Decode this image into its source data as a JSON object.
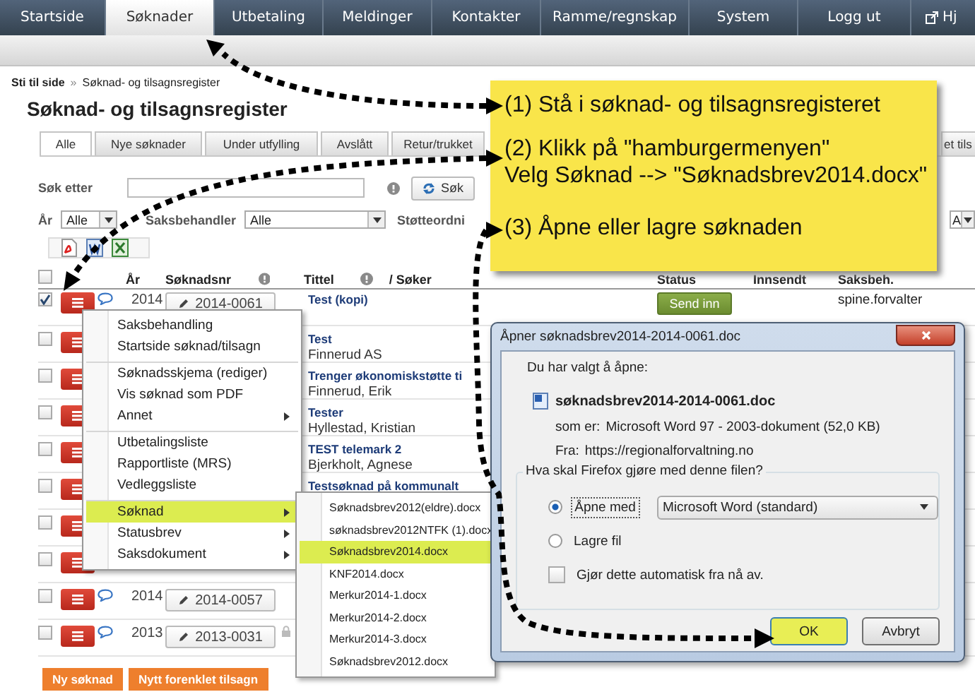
{
  "nav": [
    {
      "label": "Startside",
      "selected": false,
      "kind": "page"
    },
    {
      "label": "Søknader",
      "selected": true,
      "kind": "page"
    },
    {
      "label": "Utbetaling",
      "selected": false,
      "kind": "page"
    },
    {
      "label": "Meldinger",
      "selected": false,
      "kind": "page"
    },
    {
      "label": "Kontakter",
      "selected": false,
      "kind": "page"
    },
    {
      "label": "Ramme/regnskap",
      "selected": false,
      "kind": "page"
    },
    {
      "label": "System",
      "selected": false,
      "kind": "page"
    },
    {
      "label": "Logg ut",
      "selected": false,
      "kind": "page"
    },
    {
      "label": "Hj",
      "selected": false,
      "kind": "external"
    }
  ],
  "breadcrumb": {
    "link": "Sti til side",
    "separator": "»",
    "current": "Søknad- og tilsagnsregister"
  },
  "page_title": "Søknad- og tilsagnsregister",
  "tabs": [
    {
      "label": "Alle",
      "selected": true
    },
    {
      "label": "Nye søknader",
      "selected": false
    },
    {
      "label": "Under utfylling",
      "selected": false
    },
    {
      "label": "Avslått",
      "selected": false
    },
    {
      "label": "Retur/trukket",
      "selected": false
    },
    {
      "label": "et tils",
      "selected": false
    }
  ],
  "search": {
    "label": "Søk etter",
    "button": "Søk"
  },
  "filters": [
    {
      "label": "År",
      "value": "Alle"
    },
    {
      "label": "Saksbehandler",
      "value": "Alle"
    },
    {
      "label": "Støtteordni"
    },
    {
      "value": "A"
    }
  ],
  "table": {
    "all_checked": false,
    "columns": [
      {
        "label": "År"
      },
      {
        "label": "Søknadsnr",
        "help": true
      },
      {
        "label": "Tittel",
        "help": true,
        "suffix": "/ Søker"
      },
      {
        "label": "Status"
      },
      {
        "label": "Innsendt"
      },
      {
        "label": "Saksbeh."
      }
    ],
    "rows": [
      {
        "checked": true,
        "comment": true,
        "year": "2014",
        "number": "2014-0061",
        "title": "Test (kopi)",
        "status": "Send inn",
        "handler": "spine.forvalter"
      },
      {
        "checked": false,
        "title": "Test",
        "applicant": "Finnerud AS"
      },
      {
        "checked": false,
        "title": "Trenger økonomiskstøtte ti",
        "applicant": "Finnerud, Erik"
      },
      {
        "checked": false,
        "title": "Tester",
        "applicant": "Hyllestad, Kristian"
      },
      {
        "checked": false,
        "title": "TEST telemark 2",
        "applicant": "Bjerkholt, Agnese"
      },
      {
        "checked": false,
        "title": "Testsøknad på kommunalt"
      },
      {
        "checked": false
      },
      {
        "checked": false
      },
      {
        "checked": false,
        "comment": true,
        "year": "2014",
        "number": "2014-0057"
      },
      {
        "checked": false,
        "comment": true,
        "year": "2013",
        "number": "2013-0031",
        "locked": true
      }
    ]
  },
  "actions": [
    "Ny søknad",
    "Nytt forenklet tilsagn"
  ],
  "context_menu": [
    {
      "label": "Saksbehandling",
      "submenu": false,
      "selected": false,
      "separator_before": false
    },
    {
      "label": "Startside søknad/tilsagn",
      "submenu": false,
      "selected": false,
      "separator_before": false
    },
    {
      "label": "Søknadsskjema (rediger)",
      "submenu": false,
      "selected": false,
      "separator_before": true
    },
    {
      "label": "Vis søknad som PDF",
      "submenu": false,
      "selected": false,
      "separator_before": false
    },
    {
      "label": "Annet",
      "submenu": true,
      "selected": false,
      "separator_before": false
    },
    {
      "label": "Utbetalingsliste",
      "submenu": false,
      "selected": false,
      "separator_before": true
    },
    {
      "label": "Rapportliste (MRS)",
      "submenu": false,
      "selected": false,
      "separator_before": false
    },
    {
      "label": "Vedleggsliste",
      "submenu": false,
      "selected": false,
      "separator_before": false
    },
    {
      "label": "Søknad",
      "submenu": true,
      "selected": true,
      "separator_before": true
    },
    {
      "label": "Statusbrev",
      "submenu": true,
      "selected": false,
      "separator_before": false
    },
    {
      "label": "Saksdokument",
      "submenu": true,
      "selected": false,
      "separator_before": false
    }
  ],
  "submenu": [
    {
      "label": "Søknadsbrev2012(eldre).docx",
      "selected": false
    },
    {
      "label": "søknadsbrev2012NTFK (1).docx",
      "selected": false
    },
    {
      "label": "Søknadsbrev2014.docx",
      "selected": true
    },
    {
      "label": "KNF2014.docx",
      "selected": false
    },
    {
      "label": "Merkur2014-1.docx",
      "selected": false
    },
    {
      "label": "Merkur2014-2.docx",
      "selected": false
    },
    {
      "label": "Merkur2014-3.docx",
      "selected": false
    },
    {
      "label": "Søknadsbrev2012.docx",
      "selected": false
    }
  ],
  "dialog": {
    "title": "Åpner søknadsbrev2014-2014-0061.doc",
    "intro": "Du har valgt å åpne:",
    "file_name": "søknadsbrev2014-2014-0061.doc",
    "details": [
      {
        "label": "som er:",
        "value": "Microsoft Word 97 - 2003-dokument (52,0 KB)"
      },
      {
        "label": "Fra:",
        "value": "https://regionalforvaltning.no"
      }
    ],
    "question": "Hva skal Firefox gjøre med denne filen?",
    "options": [
      {
        "label": "Åpne med",
        "selected": true,
        "app": "Microsoft Word (standard)"
      },
      {
        "label": "Lagre fil",
        "selected": false
      }
    ],
    "auto": {
      "label": "Gjør dette automatisk fra nå av.",
      "checked": false
    },
    "buttons": [
      {
        "label": "OK",
        "highlighted": true
      },
      {
        "label": "Avbryt",
        "highlighted": false
      }
    ]
  },
  "callout": {
    "steps": [
      {
        "lines": [
          "(1) Stå i søknad- og tilsagnsregisteret"
        ]
      },
      {
        "lines": [
          "(2) Klikk på \"hamburgermenyen\"",
          "Velg Søknad --> \"Søknadsbrev2014.docx\""
        ]
      },
      {
        "lines": [
          "(3) Åpne eller lagre søknaden"
        ]
      }
    ]
  }
}
